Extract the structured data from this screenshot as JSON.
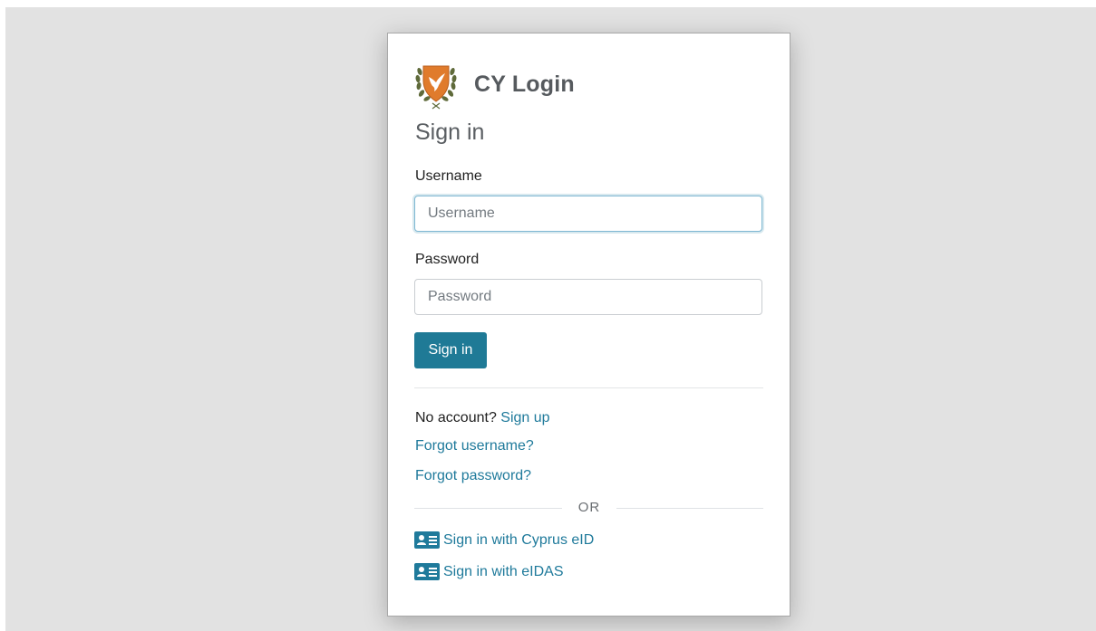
{
  "brand": {
    "name": "CY Login",
    "logo_icon": "cyprus-coat-of-arms-icon"
  },
  "form": {
    "heading": "Sign in",
    "username": {
      "label": "Username",
      "placeholder": "Username",
      "value": ""
    },
    "password": {
      "label": "Password",
      "placeholder": "Password",
      "value": ""
    },
    "submit_label": "Sign in"
  },
  "links": {
    "no_account_prefix": "No account?",
    "sign_up": "Sign up",
    "forgot_username": "Forgot username?",
    "forgot_password": "Forgot password?"
  },
  "separator": {
    "text": "OR"
  },
  "external_logins": [
    {
      "label": "Sign in with Cyprus eID",
      "icon": "id-card-icon"
    },
    {
      "label": "Sign in with eIDAS",
      "icon": "id-card-icon"
    }
  ],
  "colors": {
    "accent": "#1f7a96",
    "link": "#1f7a9b",
    "background": "#e2e2e2",
    "logo_orange": "#e07b2c"
  }
}
